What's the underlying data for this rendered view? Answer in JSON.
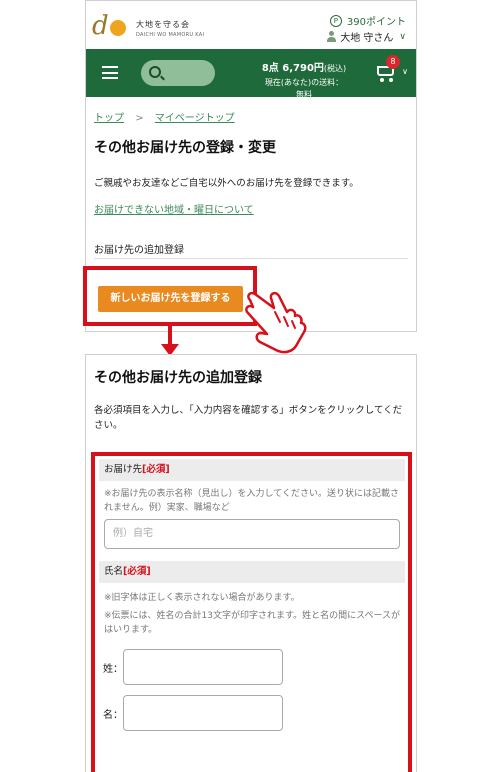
{
  "header": {
    "logo_letter": "d",
    "logo_jp": "大地を守る会",
    "logo_en": "DAICHI WO MAMORU KAI",
    "points_icon": "P",
    "points": "390ポイント",
    "user_name": "大地 守さん",
    "user_chevron": "∨"
  },
  "navbar": {
    "cart_total": "8点 6,790円",
    "cart_total_tax": "(税込)",
    "cart_shipping_line1": "現在(あなた)の送料：",
    "cart_shipping_line2": "無料",
    "cart_badge": "8",
    "cart_chevron": "∨"
  },
  "panel1": {
    "breadcrumb": [
      "トップ",
      "マイページトップ"
    ],
    "breadcrumb_sep": ">",
    "title": "その他お届け先の登録・変更",
    "description": "ご親戚やお友達などご自宅以外へのお届け先を登録できます。",
    "link": "お届けできない地域・曜日について",
    "section_label": "お届け先の追加登録",
    "new_button": "新しいお届け先を登録する"
  },
  "panel2": {
    "title": "その他お届け先の追加登録",
    "description": "各必須項目を入力し、「入力内容を確認する」ボタンをクリックしてください。",
    "fields": {
      "destination": {
        "label": "お届け先",
        "required": "[必須]",
        "note": "※お届け先の表示名称（見出し）を入力してください。送り状には記載されません。例）実家、職場など",
        "placeholder": "例）自宅"
      },
      "name": {
        "label": "氏名",
        "required": "[必須]",
        "note1": "※旧字体は正しく表示されない場合があります。",
        "note2": "※伝票には、姓名の合計13文字が印字されます。姓と名の間にスペースがはいります。",
        "last_label": "姓：",
        "first_label": "名："
      }
    }
  },
  "colors": {
    "brand_green": "#1f6a3a",
    "link_green": "#3a8a5a",
    "button_orange": "#e88a1f",
    "callout_red": "#d7111b"
  }
}
